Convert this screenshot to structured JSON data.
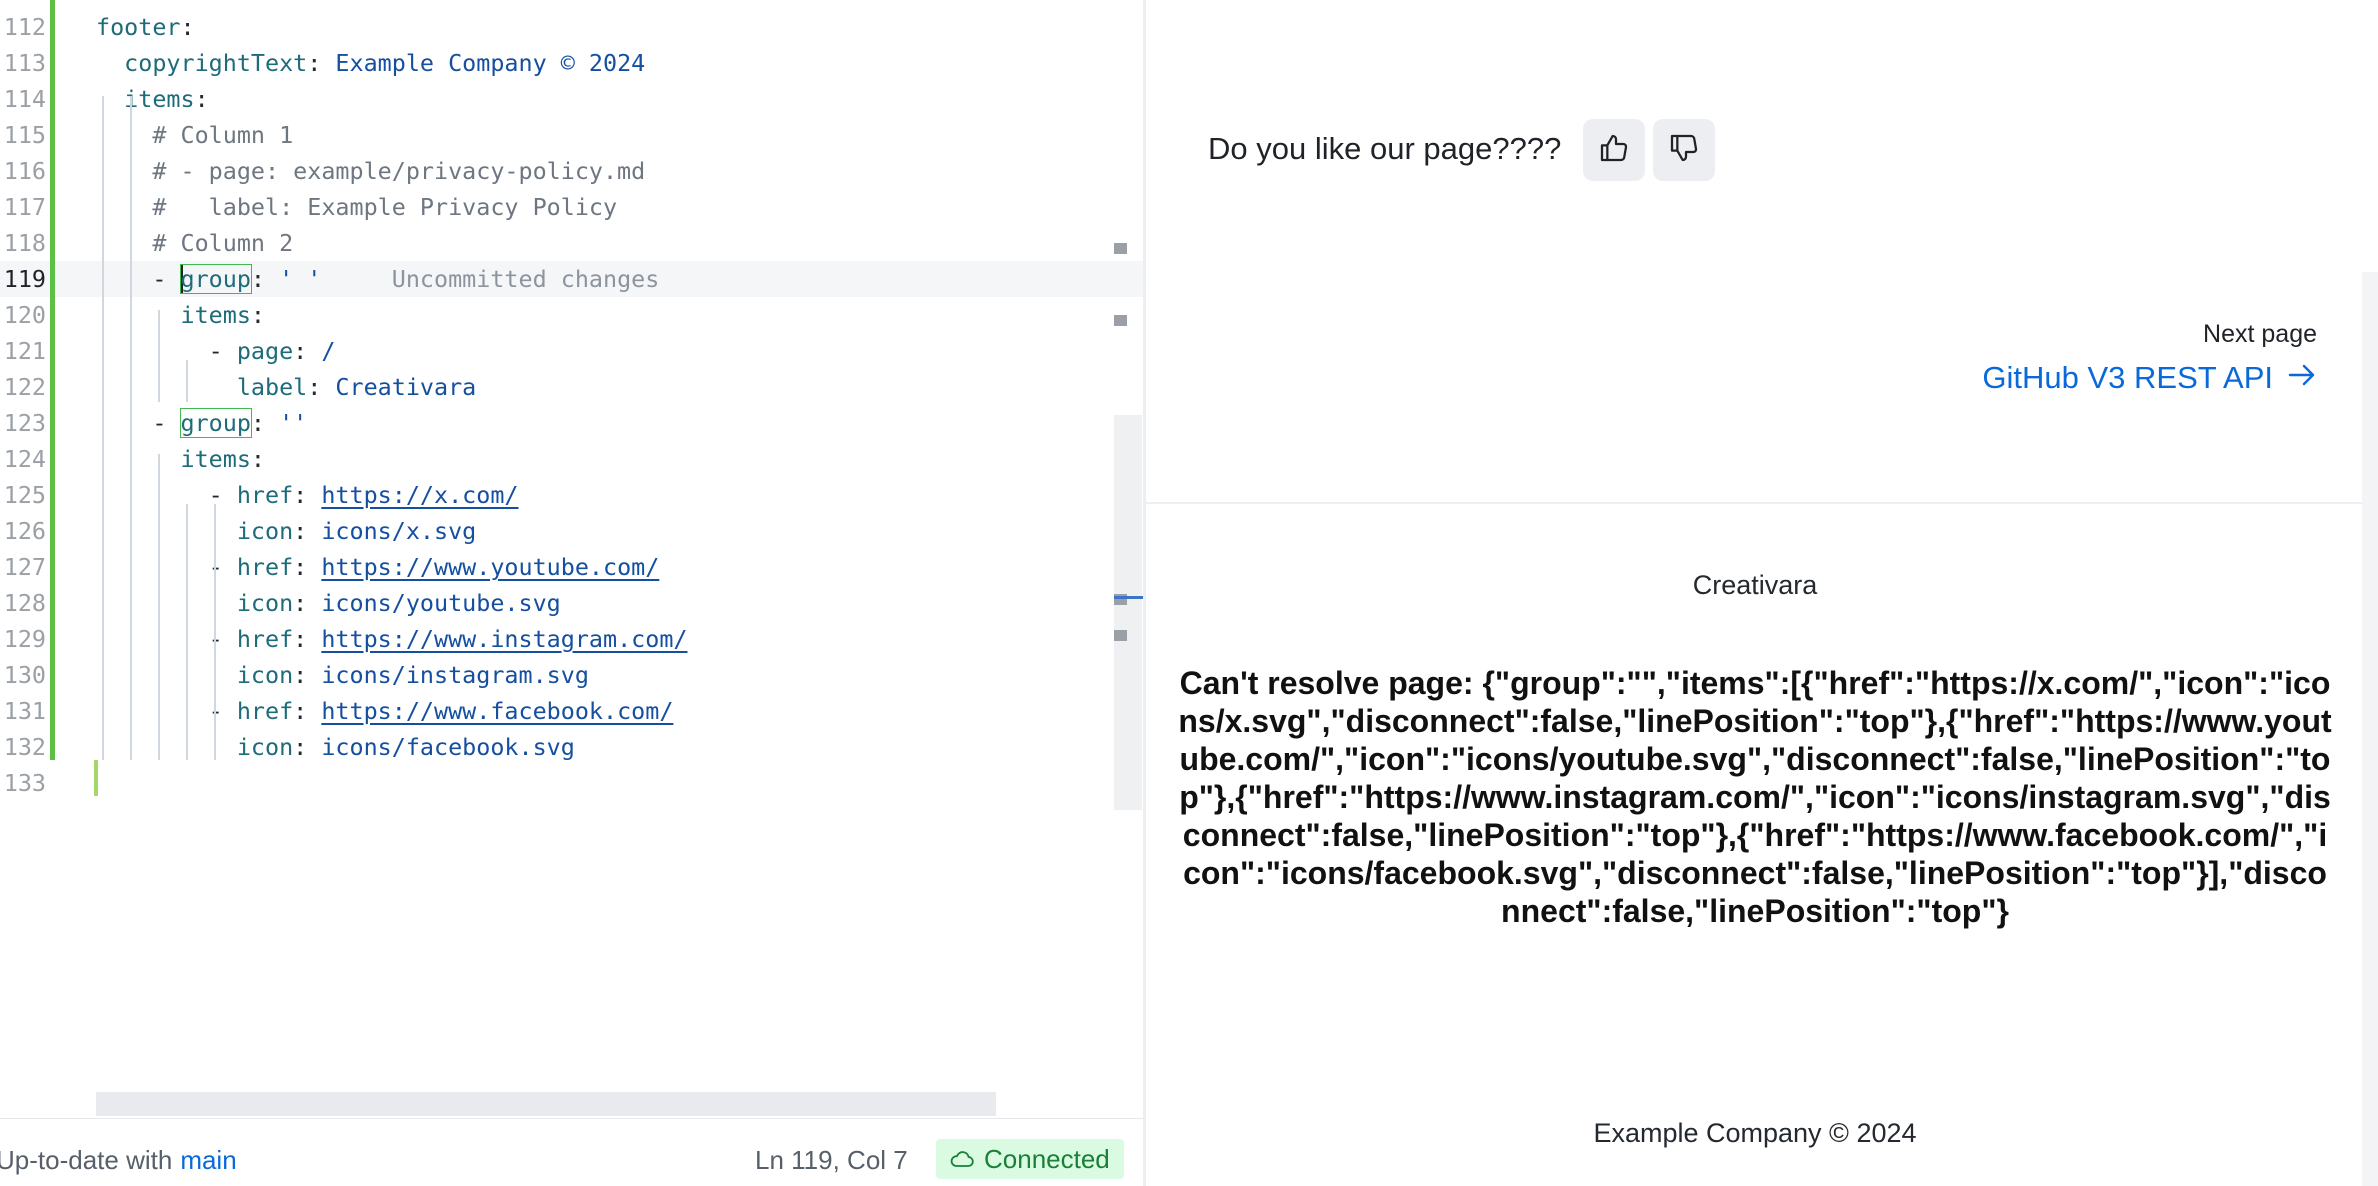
{
  "editor": {
    "lines": [
      {
        "n": "112",
        "tokens": [
          [
            "k",
            "footer"
          ],
          [
            "p",
            ":"
          ]
        ]
      },
      {
        "n": "113",
        "tokens": [
          [
            "p",
            "  "
          ],
          [
            "k",
            "copyrightText"
          ],
          [
            "p",
            ": "
          ],
          [
            "v",
            "Example Company © 2024"
          ]
        ]
      },
      {
        "n": "114",
        "tokens": [
          [
            "p",
            "  "
          ],
          [
            "k",
            "items"
          ],
          [
            "p",
            ":"
          ]
        ]
      },
      {
        "n": "115",
        "tokens": [
          [
            "p",
            "    "
          ],
          [
            "c",
            "# Column 1"
          ]
        ]
      },
      {
        "n": "116",
        "tokens": [
          [
            "p",
            "    "
          ],
          [
            "c",
            "# - page: example/privacy-policy.md"
          ]
        ]
      },
      {
        "n": "117",
        "tokens": [
          [
            "p",
            "    "
          ],
          [
            "c",
            "#   label: Example Privacy Policy"
          ]
        ]
      },
      {
        "n": "118",
        "tokens": [
          [
            "p",
            "    "
          ],
          [
            "c",
            "# Column 2"
          ]
        ]
      },
      {
        "n": "119",
        "current": true,
        "tokens": [
          [
            "p",
            "    - "
          ],
          [
            "caret",
            ""
          ],
          [
            "kb",
            "group"
          ],
          [
            "p",
            ": "
          ],
          [
            "v",
            "' '"
          ],
          [
            "hint",
            "     Uncommitted changes"
          ]
        ]
      },
      {
        "n": "120",
        "tokens": [
          [
            "p",
            "      "
          ],
          [
            "k",
            "items"
          ],
          [
            "p",
            ":"
          ]
        ]
      },
      {
        "n": "121",
        "tokens": [
          [
            "p",
            "        - "
          ],
          [
            "k",
            "page"
          ],
          [
            "p",
            ": "
          ],
          [
            "v",
            "/"
          ]
        ]
      },
      {
        "n": "122",
        "tokens": [
          [
            "p",
            "          "
          ],
          [
            "k",
            "label"
          ],
          [
            "p",
            ": "
          ],
          [
            "v",
            "Creativara"
          ]
        ]
      },
      {
        "n": "123",
        "tokens": [
          [
            "p",
            "    - "
          ],
          [
            "kb",
            "group"
          ],
          [
            "p",
            ": "
          ],
          [
            "v",
            "''"
          ]
        ]
      },
      {
        "n": "124",
        "tokens": [
          [
            "p",
            "      "
          ],
          [
            "k",
            "items"
          ],
          [
            "p",
            ":"
          ]
        ]
      },
      {
        "n": "125",
        "tokens": [
          [
            "p",
            "        - "
          ],
          [
            "k",
            "href"
          ],
          [
            "p",
            ": "
          ],
          [
            "u",
            "https://x.com/"
          ]
        ]
      },
      {
        "n": "126",
        "tokens": [
          [
            "p",
            "          "
          ],
          [
            "k",
            "icon"
          ],
          [
            "p",
            ": "
          ],
          [
            "v",
            "icons/x.svg"
          ]
        ]
      },
      {
        "n": "127",
        "tokens": [
          [
            "p",
            "        - "
          ],
          [
            "k",
            "href"
          ],
          [
            "p",
            ": "
          ],
          [
            "u",
            "https://www.youtube.com/"
          ]
        ]
      },
      {
        "n": "128",
        "tokens": [
          [
            "p",
            "          "
          ],
          [
            "k",
            "icon"
          ],
          [
            "p",
            ": "
          ],
          [
            "v",
            "icons/youtube.svg"
          ]
        ]
      },
      {
        "n": "129",
        "tokens": [
          [
            "p",
            "        - "
          ],
          [
            "k",
            "href"
          ],
          [
            "p",
            ": "
          ],
          [
            "u",
            "https://www.instagram.com/"
          ]
        ]
      },
      {
        "n": "130",
        "tokens": [
          [
            "p",
            "          "
          ],
          [
            "k",
            "icon"
          ],
          [
            "p",
            ": "
          ],
          [
            "v",
            "icons/instagram.svg"
          ]
        ]
      },
      {
        "n": "131",
        "tokens": [
          [
            "p",
            "        - "
          ],
          [
            "k",
            "href"
          ],
          [
            "p",
            ": "
          ],
          [
            "u",
            "https://www.facebook.com/"
          ]
        ]
      },
      {
        "n": "132",
        "tokens": [
          [
            "p",
            "          "
          ],
          [
            "k",
            "icon"
          ],
          [
            "p",
            ": "
          ],
          [
            "v",
            "icons/facebook.svg"
          ]
        ]
      },
      {
        "n": "133",
        "tokens": []
      }
    ]
  },
  "statusbar": {
    "sync_text": "Up-to-date with",
    "branch": "main",
    "cursor": "Ln 119, Col 7",
    "connection": "Connected",
    "connection_icon": "cloud-icon"
  },
  "preview": {
    "feedback_question": "Do you like our page????",
    "thumbs_up_icon": "thumbs-up-icon",
    "thumbs_down_icon": "thumbs-down-icon",
    "next_label": "Next page",
    "next_link": "GitHub V3 REST API",
    "footer_title": "Creativara",
    "error": "Can't resolve page: {\"group\":\"\",\"items\":[{\"href\":\"https://x.com/\",\"icon\":\"icons/x.svg\",\"disconnect\":false,\"linePosition\":\"top\"},{\"href\":\"https://www.youtube.com/\",\"icon\":\"icons/youtube.svg\",\"disconnect\":false,\"linePosition\":\"top\"},{\"href\":\"https://www.instagram.com/\",\"icon\":\"icons/instagram.svg\",\"disconnect\":false,\"linePosition\":\"top\"},{\"href\":\"https://www.facebook.com/\",\"icon\":\"icons/facebook.svg\",\"disconnect\":false,\"linePosition\":\"top\"}],\"disconnect\":false,\"linePosition\":\"top\"}",
    "copyright": "Example Company © 2024"
  },
  "colors": {
    "accent": "#0969da",
    "change_bar": "#5cc045",
    "connected_bg": "#dafbe1",
    "connected_fg": "#1a7f37"
  }
}
